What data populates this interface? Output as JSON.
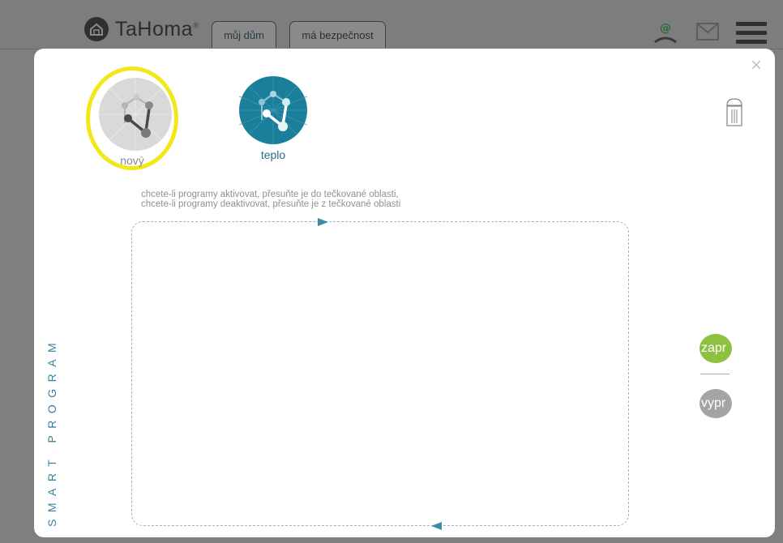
{
  "header": {
    "brand": "TaHoma",
    "brand_mark": "®",
    "tabs": [
      {
        "label": "můj dům"
      },
      {
        "label": "má bezpečnost"
      }
    ],
    "email_icon_text": "@"
  },
  "modal": {
    "programs": [
      {
        "label": "nový",
        "selected": true
      },
      {
        "label": "teplo",
        "selected": false
      }
    ],
    "hint_line1": "chcete-li programy aktivovat, přesuňte je do tečkované oblasti,",
    "hint_line2": "chcete-li programy deaktivovat, přesuňte je z tečkované oblasti",
    "side_label": "SMART PROGRAM",
    "toggle_on": "zapr",
    "toggle_off": "vypr",
    "close_symbol": "×",
    "colors": {
      "selection_ring": "#f2e719",
      "program_teal": "#1a7f9b",
      "toggle_on": "#8cc23f",
      "toggle_off": "#a4a4a4",
      "accent_text": "#3d7f9a"
    }
  }
}
